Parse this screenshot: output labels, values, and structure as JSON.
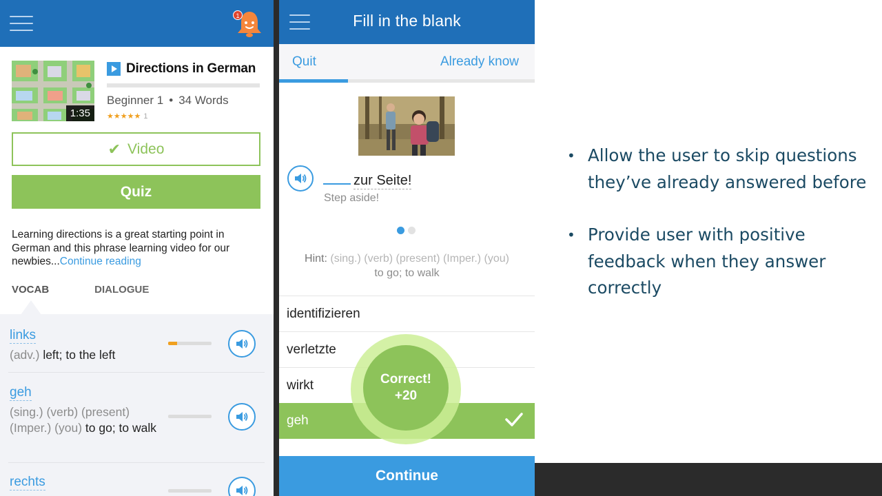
{
  "left_phone": {
    "notification_count": "1",
    "lesson": {
      "title": "Directions in German",
      "duration": "1:35",
      "level": "Beginner 1",
      "separator": "•",
      "word_count": "34 Words",
      "stars": "★★★★★",
      "rating_count": "1",
      "progress": 0
    },
    "video_button": "Video",
    "quiz_button": "Quiz",
    "description": "Learning directions is a great starting point in German and this phrase learning video for our newbies...",
    "continue_reading": "Continue reading",
    "tabs": [
      "VOCAB",
      "DIALOGUE"
    ],
    "vocab": [
      {
        "word": "links",
        "pos": "(adv.)",
        "meaning": "left; to the left",
        "progress": 0.2
      },
      {
        "word": "geh",
        "pos": "(sing.) (verb) (present) (Imper.) (you)",
        "meaning": "to go; to walk",
        "progress": 0
      },
      {
        "word": "rechts",
        "pos": "",
        "meaning": "",
        "progress": 0
      }
    ]
  },
  "right_phone": {
    "title": "Fill in the blank",
    "quit": "Quit",
    "already_know": "Already know",
    "progress": 0.27,
    "sentence": "zur Seite!",
    "translation": "Step aside!",
    "hint_label": "Hint:",
    "hint_pos": "(sing.) (verb) (present) (Imper.) (you)",
    "hint_meaning": "to go; to walk",
    "options": [
      "identifizieren",
      "verletzte",
      "wirkt",
      "geh"
    ],
    "correct_option_index": 3,
    "feedback_title": "Correct!",
    "feedback_points": "+20",
    "continue_button": "Continue"
  },
  "slide": {
    "bullets": [
      "Allow the user to skip questions they’ve already answered before",
      "Provide user with positive feedback when they answer correctly"
    ]
  },
  "colors": {
    "header_blue": "#1f6fb8",
    "accent_blue": "#3a9be0",
    "green": "#8dc35a",
    "bullet_text": "#1b4a63",
    "bell_orange": "#f5863c"
  }
}
